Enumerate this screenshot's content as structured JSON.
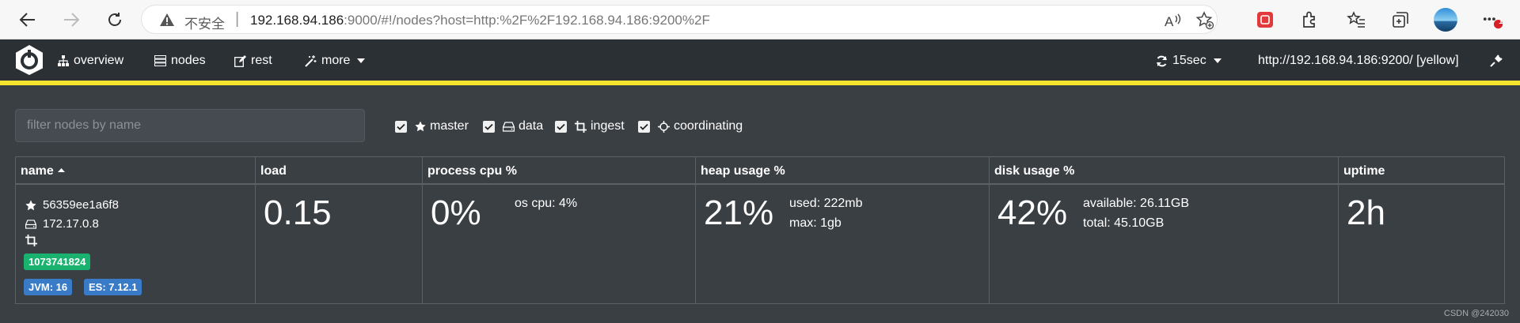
{
  "browser": {
    "insecure_label": "不安全",
    "separator": "|",
    "url_host": "192.168.94.186",
    "url_rest": ":9000/#!/nodes?host=http:%2F%2F192.168.94.186:9200%2F",
    "icons": [
      "back-icon",
      "forward-icon",
      "reload-icon",
      "warning-icon",
      "read-aloud-icon",
      "favorite-add-icon",
      "extension-red-icon",
      "extensions-icon",
      "favorites-icon",
      "collections-icon",
      "profile-avatar",
      "more-icon"
    ],
    "notification_count": "1"
  },
  "navbar": {
    "items": [
      "overview",
      "nodes",
      "rest",
      "more"
    ],
    "refresh_interval": "15sec",
    "cluster_url": "http://192.168.94.186:9200/ [yellow]",
    "cluster_status_color": "#f4e42d"
  },
  "filter": {
    "placeholder": "filter nodes by name",
    "roles": [
      {
        "label": "master",
        "checked": true
      },
      {
        "label": "data",
        "checked": true
      },
      {
        "label": "ingest",
        "checked": true
      },
      {
        "label": "coordinating",
        "checked": true
      }
    ]
  },
  "table": {
    "headers": {
      "name": "name",
      "load": "load",
      "cpu": "process cpu %",
      "heap": "heap usage %",
      "disk": "disk usage %",
      "uptime": "uptime"
    },
    "rows": [
      {
        "name": "56359ee1a6f8",
        "ip": "172.17.0.8",
        "badge_green": "1073741824",
        "badge_jvm": "JVM: 16",
        "badge_es": "ES: 7.12.1",
        "load": "0.15",
        "cpu_value": "0%",
        "os_cpu": "os cpu: 4%",
        "heap_value": "21%",
        "heap_used": "used: 222mb",
        "heap_max": "max: 1gb",
        "disk_value": "42%",
        "disk_available": "available: 26.11GB",
        "disk_total": "total: 45.10GB",
        "uptime": "2h"
      }
    ]
  },
  "watermark": "CSDN @242030"
}
